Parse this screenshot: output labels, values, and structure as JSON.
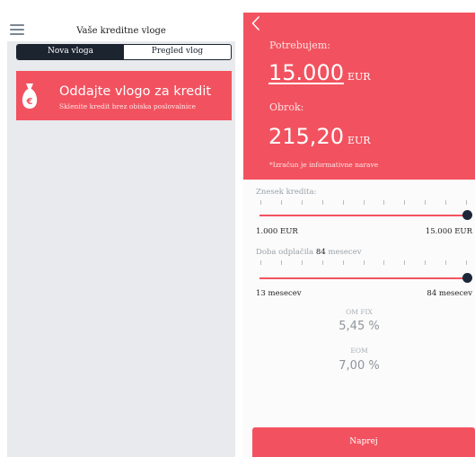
{
  "left_panel": {
    "title": "Vaše kreditne vloge",
    "tabs": [
      {
        "label": "Nova vloga",
        "active": true
      },
      {
        "label": "Pregled vlog",
        "active": false
      }
    ],
    "banner": {
      "title": "Oddajte vlogo za kredit",
      "subtitle": "Sklenite kredit brez obiska poslovalnice",
      "icon": "money-bag-icon"
    }
  },
  "summary": {
    "need_label": "Potrebujem:",
    "amount": "15.000",
    "amount_unit": "EUR",
    "installment_label": "Obrok:",
    "installment": "215,20",
    "installment_unit": "EUR",
    "disclaimer": "*Izračun je informativne narave"
  },
  "loan_amount_slider": {
    "label": "Znesek kredita:",
    "min_label": "1.000 EUR",
    "max_label": "15.000 EUR",
    "min": 1000,
    "max": 15000,
    "value": 15000
  },
  "term_slider": {
    "label_prefix": "Doba odplačila",
    "value_text": "84",
    "label_suffix": "mesecev",
    "min_label": "13 mesecev",
    "max_label": "84 mesecev",
    "min": 13,
    "max": 84,
    "value": 84
  },
  "rates": {
    "om_fix_label": "OM FIX",
    "om_fix_value": "5,45 %",
    "eom_label": "EOM",
    "eom_value": "7,00 %"
  },
  "cta": {
    "label": "Naprej"
  },
  "colors": {
    "accent": "#f2525f",
    "dark": "#1c2838",
    "panel_bg": "#e8eaed"
  }
}
